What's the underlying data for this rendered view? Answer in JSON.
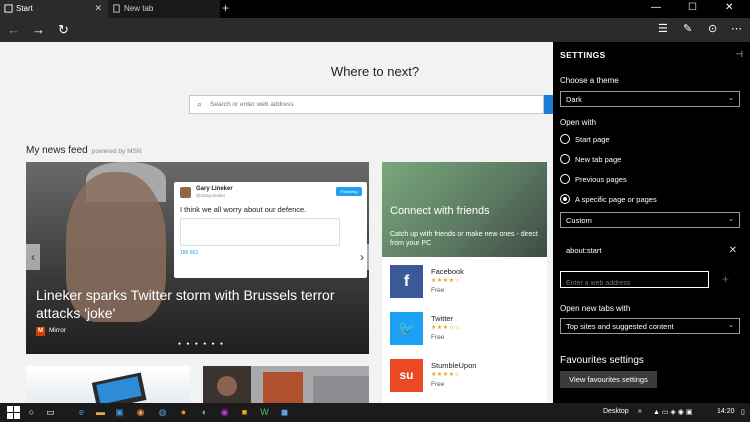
{
  "tabs": [
    {
      "label": "Start",
      "close": "✕"
    },
    {
      "label": "New tab",
      "close": ""
    }
  ],
  "new_tab_symbol": "+",
  "window_controls": {
    "minimize": "—",
    "maximize": "☐",
    "close": "✕"
  },
  "nav": {
    "back_icon": "←",
    "forward_icon": "→",
    "refresh_icon": "↻",
    "hub_icon": "☰",
    "note_icon": "✎",
    "share_icon": "⊙",
    "more_icon": "⋯"
  },
  "main": {
    "heading": "Where to next?",
    "search_placeholder": "Search or enter web address",
    "news_feed_title": "My news feed",
    "powered_by": "powered by MSN",
    "hero": {
      "title": "Lineker sparks Twitter storm with Brussels terror attacks 'joke'",
      "source_logo": "M",
      "source": "Mirror",
      "dots": "● ● ● ● ● ●",
      "prev_arrow": "‹",
      "next_arrow": "›",
      "tweet": {
        "name": "Gary Lineker",
        "handle": "@GaryLineker",
        "follow": "Following",
        "text": "I think we all worry about our defence.",
        "stats": "189   663"
      }
    },
    "connect": {
      "heading": "Connect with friends",
      "description": "Catch up with friends or make new ones - direct from your PC"
    },
    "apps": [
      {
        "name": "Facebook",
        "stars": "★★★★☆",
        "price": "Free",
        "logo": "f",
        "color": "#3b5998"
      },
      {
        "name": "Twitter",
        "stars": "★★★☆☆",
        "price": "Free",
        "logo": "🐦",
        "color": "#1da1f2"
      },
      {
        "name": "StumbleUpon",
        "stars": "★★★★☆",
        "price": "Free",
        "logo": "su",
        "color": "#eb4924"
      }
    ]
  },
  "settings": {
    "title": "SETTINGS",
    "pin_icon": "⊣",
    "theme_label": "Choose a theme",
    "theme_value": "Dark",
    "open_with_label": "Open with",
    "open_with_options": [
      "Start page",
      "New tab page",
      "Previous pages",
      "A specific page or pages"
    ],
    "selected_option": "A specific page or pages",
    "pages_select_value": "Custom",
    "page_entry": "about:start",
    "page_entry_remove": "✕",
    "web_address_placeholder": "Enter a web address",
    "add_symbol": "+",
    "new_tabs_label": "Open new tabs with",
    "new_tabs_value": "Top sites and suggested content",
    "favourites_title": "Favourites settings",
    "favourites_button": "View favourites settings"
  },
  "taskbar": {
    "desktop_label": "Desktop",
    "time": "14:20",
    "chevron": "»"
  }
}
